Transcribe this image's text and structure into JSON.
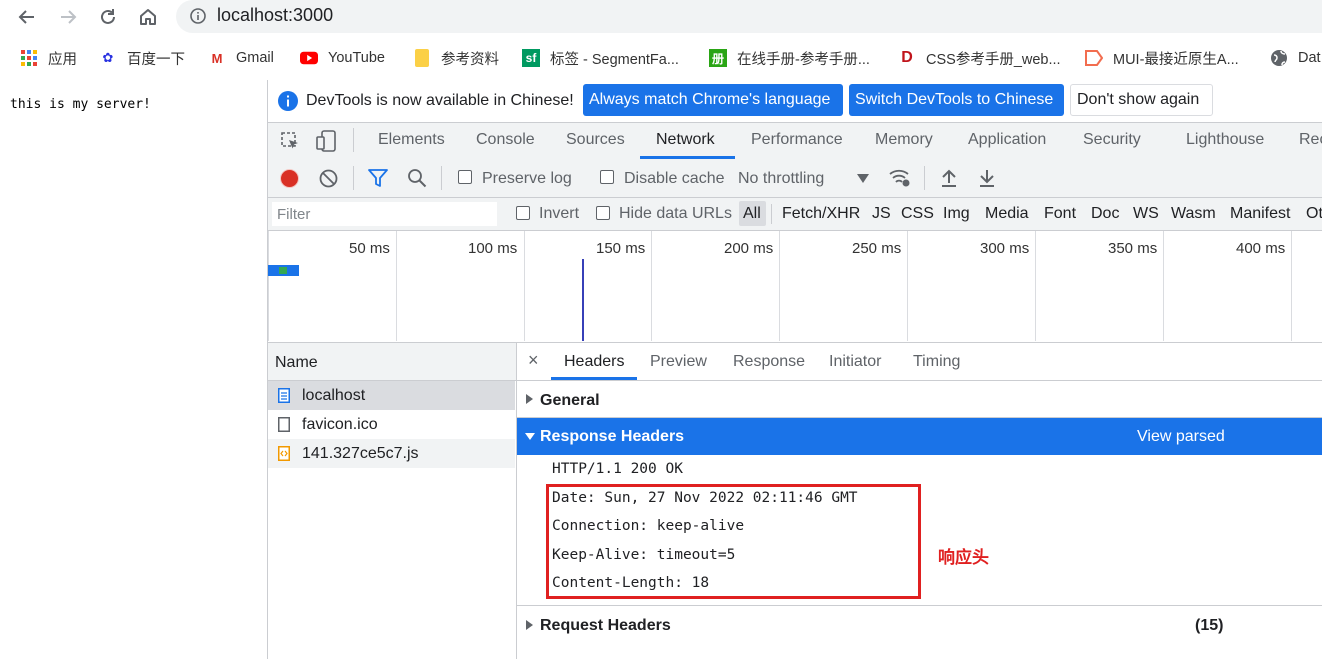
{
  "browser": {
    "url": "localhost:3000",
    "bookmarks": [
      {
        "label": "应用",
        "icon": "apps-grid-icon"
      },
      {
        "label": "百度一下",
        "icon": "baidu-paw-icon"
      },
      {
        "label": "Gmail",
        "icon": "gmail-icon"
      },
      {
        "label": "YouTube",
        "icon": "youtube-icon"
      },
      {
        "label": "参考资料",
        "icon": "folder-icon"
      },
      {
        "label": "标签 - SegmentFa...",
        "icon": "segmentfault-icon"
      },
      {
        "label": "在线手册-参考手册...",
        "icon": "manual-icon"
      },
      {
        "label": "CSS参考手册_web...",
        "icon": "css-ref-icon"
      },
      {
        "label": "MUI-最接近原生A...",
        "icon": "mui-icon"
      },
      {
        "label": "Dat",
        "icon": "globe-icon"
      }
    ]
  },
  "page": {
    "body_text": "this is my server!"
  },
  "devtools": {
    "banner": {
      "message": "DevTools is now available in Chinese!",
      "btn_match": "Always match Chrome's language",
      "btn_switch": "Switch DevTools to Chinese",
      "btn_dismiss": "Don't show again"
    },
    "tabs": [
      "Elements",
      "Console",
      "Sources",
      "Network",
      "Performance",
      "Memory",
      "Application",
      "Security",
      "Lighthouse",
      "Rec"
    ],
    "active_tab": "Network",
    "toolbar": {
      "preserve_log": "Preserve log",
      "disable_cache": "Disable cache",
      "throttling": "No throttling"
    },
    "filter": {
      "placeholder": "Filter",
      "invert": "Invert",
      "hide_data_urls": "Hide data URLs",
      "types": [
        "All",
        "Fetch/XHR",
        "JS",
        "CSS",
        "Img",
        "Media",
        "Font",
        "Doc",
        "WS",
        "Wasm",
        "Manifest",
        "Ot"
      ]
    },
    "timeline_ticks": [
      "50 ms",
      "100 ms",
      "150 ms",
      "200 ms",
      "250 ms",
      "300 ms",
      "350 ms",
      "400 ms"
    ],
    "requests": {
      "column": "Name",
      "items": [
        "localhost",
        "favicon.ico",
        "141.327ce5c7.js"
      ]
    },
    "detail": {
      "close": "×",
      "tabs": [
        "Headers",
        "Preview",
        "Response",
        "Initiator",
        "Timing"
      ],
      "active_tab": "Headers",
      "general": "General",
      "response_headers": "Response Headers",
      "view_parsed": "View parsed",
      "status_line": "HTTP/1.1 200 OK",
      "headers": [
        "Date: Sun, 27 Nov 2022 02:11:46 GMT",
        "Connection: keep-alive",
        "Keep-Alive: timeout=5",
        "Content-Length: 18"
      ],
      "annotation": "响应头",
      "request_headers": "Request Headers",
      "request_headers_count": "(15)"
    }
  },
  "colors": {
    "accent_blue": "#1a73e8",
    "selected_row": "#1a73e8",
    "annotation_red": "#e02020",
    "record_red": "#d93025"
  }
}
